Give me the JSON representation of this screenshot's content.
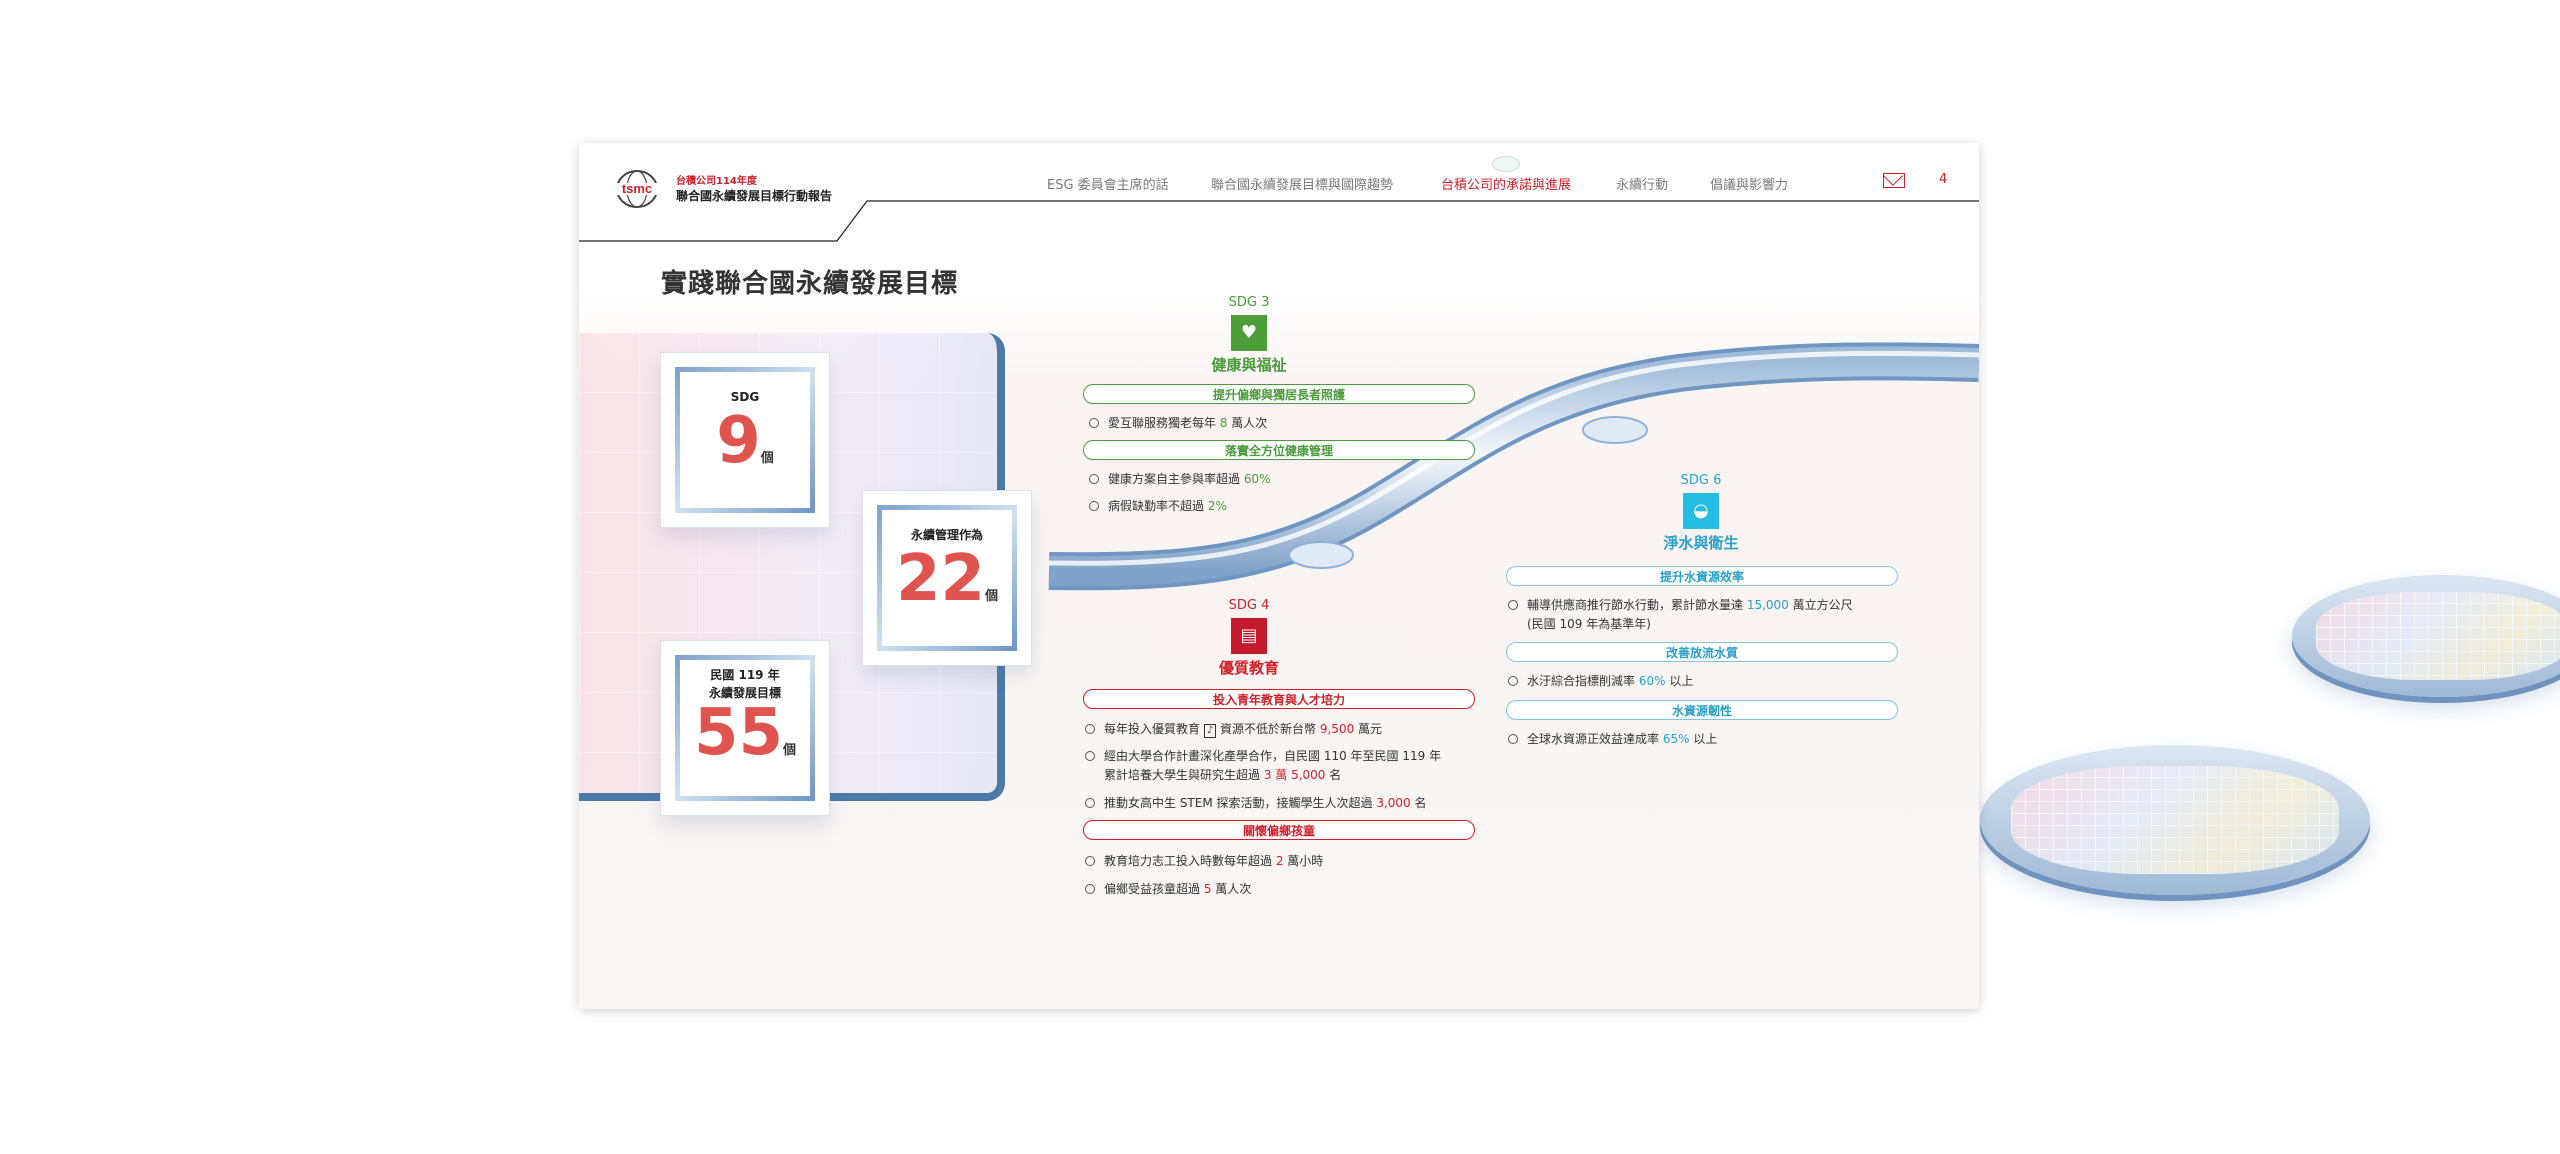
{
  "header": {
    "subtitle": "台積公司114年度",
    "report_title": "聯合國永續發展目標行動報告",
    "nav": [
      {
        "label": "ESG 委員會主席的話",
        "active": false
      },
      {
        "label": "聯合國永續發展目標與國際趨勢",
        "active": false
      },
      {
        "label": "台積公司的承諾與進展",
        "active": true
      },
      {
        "label": "永續行動",
        "active": false
      },
      {
        "label": "倡議與影響力",
        "active": false
      }
    ],
    "mail_icon": "mail-icon",
    "page_number": "4"
  },
  "page_title": "實踐聯合國永續發展目標",
  "stats": {
    "sdg": {
      "label": "SDG",
      "value": "9",
      "unit": "個"
    },
    "management": {
      "label": "永續管理作為",
      "value": "22",
      "unit": "個"
    },
    "targets": {
      "label_line1": "民國 119 年",
      "label_line2": "永續發展目標",
      "value": "55",
      "unit": "個"
    }
  },
  "sdg3": {
    "tag": "SDG 3",
    "icon": "health-heartbeat-icon",
    "name": "健康與福祉",
    "color": "#4b9a3c",
    "groups": [
      {
        "title": "提升偏鄉與獨居長者照護",
        "items": [
          {
            "pre": "愛互聯服務獨老每年 ",
            "hl": "8",
            "post": " 萬人次"
          }
        ]
      },
      {
        "title": "落實全方位健康管理",
        "items": [
          {
            "pre": "健康方案自主參與率超過 ",
            "hl": "60%",
            "post": ""
          },
          {
            "pre": "病假缺勤率不超過 ",
            "hl": "2%",
            "post": ""
          }
        ]
      }
    ]
  },
  "sdg4": {
    "tag": "SDG 4",
    "icon": "education-book-icon",
    "name": "優質教育",
    "color": "#d0202a",
    "groups": [
      {
        "title": "投入青年教育與人才培力",
        "items": [
          {
            "pre": "每年投入優質教育 ",
            "icon": "♪",
            "mid": " 資源不低於新台幣 ",
            "hl": "9,500",
            "post": " 萬元"
          },
          {
            "pre": "經由大學合作計畫深化產學合作，自民國 110 年至民國 119 年",
            "line2_pre": "累計培養大學生與研究生超過 ",
            "hl": "3 萬 5,000",
            "post": " 名"
          },
          {
            "pre": "推動女高中生 STEM 探索活動，接觸學生人次超過 ",
            "hl": "3,000",
            "post": " 名"
          }
        ]
      },
      {
        "title": "關懷偏鄉孩童",
        "items": [
          {
            "pre": "教育培力志工投入時數每年超過 ",
            "hl": "2",
            "post": " 萬小時"
          },
          {
            "pre": "偏鄉受益孩童超過 ",
            "hl": "5",
            "post": " 萬人次"
          }
        ]
      }
    ]
  },
  "sdg6": {
    "tag": "SDG 6",
    "icon": "water-drop-icon",
    "name": "淨水與衛生",
    "color": "#2ba0c6",
    "groups": [
      {
        "title": "提升水資源效率",
        "items": [
          {
            "pre": "輔導供應商推行節水行動，累計節水量達 ",
            "hl": "15,000",
            "post": " 萬立方公尺",
            "line2": "(民國 109 年為基準年)"
          }
        ]
      },
      {
        "title": "改善放流水質",
        "items": [
          {
            "pre": "水汙綜合指標削減率 ",
            "hl": "60%",
            "post": " 以上"
          }
        ]
      },
      {
        "title": "水資源韌性",
        "items": [
          {
            "pre": "全球水資源正效益達成率 ",
            "hl": "65%",
            "post": " 以上"
          }
        ]
      }
    ]
  }
}
